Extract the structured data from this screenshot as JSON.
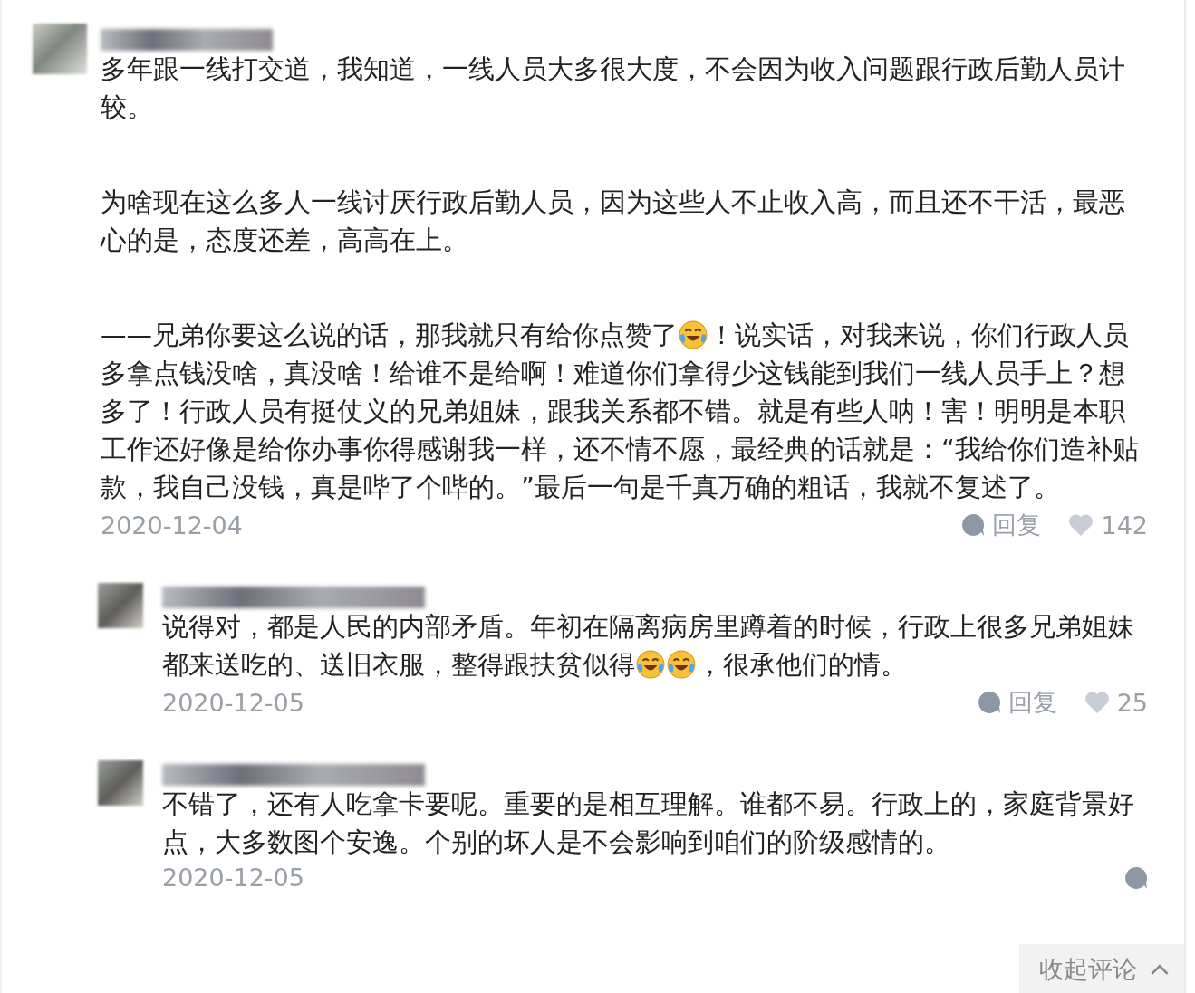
{
  "comment": {
    "paragraphs": [
      [
        {
          "kind": "text",
          "text": "多年跟一线打交道，我知道，一线人员大多很大度，不会因为收入问题跟行政后勤人员计较。"
        }
      ],
      [
        {
          "kind": "text",
          "text": "为啥现在这么多人一线讨厌行政后勤人员，因为这些人不止收入高，而且还不干活，最恶心的是，态度还差，高高在上。"
        }
      ],
      [
        {
          "kind": "text",
          "text": "——兄弟你要这么说的话，那我就只有给你点赞了"
        },
        {
          "kind": "emoji"
        },
        {
          "kind": "text",
          "text": "！说实话，对我来说，你们行政人员多拿点钱没啥，真没啥！给谁不是给啊！难道你们拿得少这钱能到我们一线人员手上？想多了！行政人员有挺仗义的兄弟姐妹，跟我关系都不错。就是有些人呐！害！明明是本职工作还好像是给你办事你得感谢我一样，还不情不愿，最经典的话就是：“我给你们造补贴款，我自己没钱，真是哔了个哔的。”最后一句是千真万确的粗话，我就不复述了。"
        }
      ]
    ],
    "date": "2020-12-04",
    "reply": "回复",
    "likes": "142",
    "replies": [
      {
        "paragraphs": [
          [
            {
              "kind": "text",
              "text": "说得对，都是人民的内部矛盾。年初在隔离病房里蹲着的时候，行政上很多兄弟姐妹都来送吃的、送旧衣服，整得跟扶贫似得"
            },
            {
              "kind": "emoji"
            },
            {
              "kind": "emoji"
            },
            {
              "kind": "text",
              "text": "，很承他们的情。"
            }
          ]
        ],
        "date": "2020-12-05",
        "reply": "回复",
        "likes": "25"
      },
      {
        "paragraphs": [
          [
            {
              "kind": "text",
              "text": "不错了，还有人吃拿卡要呢。重要的是相互理解。谁都不易。行政上的，家庭背景好点，大多数图个安逸。个别的坏人是不会影响到咱们的阶级感情的。"
            }
          ]
        ],
        "date": "2020-12-05"
      }
    ]
  },
  "collapse_button": {
    "label": "收起评论"
  }
}
